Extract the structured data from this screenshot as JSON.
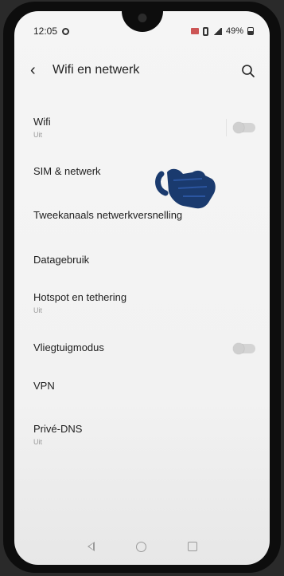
{
  "status_bar": {
    "time": "12:05",
    "battery": "49%"
  },
  "header": {
    "title": "Wifi en netwerk",
    "back_icon": "arrow-back-icon",
    "search_icon": "search-icon"
  },
  "items": [
    {
      "label": "Wifi",
      "sub": "Uit",
      "toggle": "off"
    },
    {
      "label": "SIM & netwerk"
    },
    {
      "label": "Tweekanaals netwerkversnelling"
    },
    {
      "label": "Datagebruik"
    },
    {
      "label": "Hotspot en tethering",
      "sub": "Uit"
    },
    {
      "label": "Vliegtuigmodus",
      "toggle": "off"
    },
    {
      "label": "VPN"
    },
    {
      "label": "Privé-DNS",
      "sub": "Uit"
    }
  ],
  "nav_bar": {
    "back_icon": "nav-back-icon",
    "home_icon": "nav-home-icon",
    "recents_icon": "nav-recents-icon"
  },
  "colors": {
    "background": "#f4f4f4",
    "text": "#1e1e1e",
    "subtext": "#9a9a9a",
    "hand_cursor": "#1a3a6e"
  }
}
